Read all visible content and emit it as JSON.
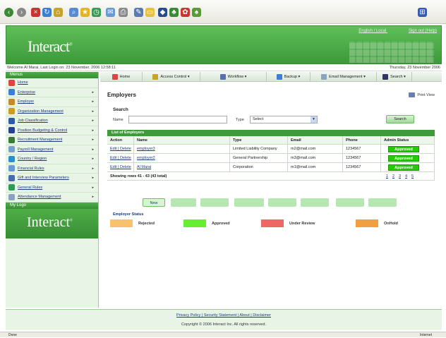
{
  "header": {
    "logo": "Interact",
    "logo_mark": "®",
    "links": [
      "English / Local",
      "Sign out (Help)"
    ]
  },
  "welcome": {
    "left": "Welcome Al Marai, Last Login on: 23 November, 2006 12:58:11",
    "right": "Thursday, 23 November 2006"
  },
  "sidebar": {
    "menu_label": "Menus",
    "items": [
      {
        "label": "Home",
        "color": "#d44"
      },
      {
        "label": "Enterprise",
        "color": "#3a7fd0"
      },
      {
        "label": "Employer",
        "color": "#c68a2a"
      },
      {
        "label": "Organization Management",
        "color": "#cc9b22"
      },
      {
        "label": "Job Classification",
        "color": "#2f5aa8"
      },
      {
        "label": "Position Budgeting & Control",
        "color": "#27418a"
      },
      {
        "label": "Recruitment Management",
        "color": "#3a7a35"
      },
      {
        "label": "Payroll Management",
        "color": "#7a9fcc"
      },
      {
        "label": "Country / Region",
        "color": "#2a8fd0"
      },
      {
        "label": "Financial Rules",
        "color": "#6a9ad4"
      },
      {
        "label": "Gift and Interview Parameters",
        "color": "#4a6ab0"
      },
      {
        "label": "General Rules",
        "color": "#2e9a54"
      },
      {
        "label": "Attendance Management",
        "color": "#8aa4c0"
      }
    ],
    "my_logo_label": "My Logo",
    "logo": "Interact"
  },
  "menubar": [
    {
      "label": "Home",
      "icon": "home-icon",
      "color": "#d44"
    },
    {
      "label": "Access Control ▾",
      "icon": "key-icon",
      "color": "#c9a22a"
    },
    {
      "label": "Workflow ▾",
      "icon": "workflow-icon",
      "color": "#5a6fb0"
    },
    {
      "label": "Backup ▾",
      "icon": "backup-icon",
      "color": "#3a7fd0"
    },
    {
      "label": "Email Management ▾",
      "icon": "email-icon",
      "color": "#8aa4c0"
    },
    {
      "label": "Search ▾",
      "icon": "search-icon",
      "color": "#336"
    }
  ],
  "page": {
    "title": "Employers",
    "print_view": "Print View"
  },
  "search": {
    "heading": "Search",
    "name_label": "Name",
    "type_label": "Type",
    "type_value": "Select",
    "button": "Search"
  },
  "table": {
    "caption": "List of Employers",
    "headers": [
      "Action",
      "Name",
      "Type",
      "Email",
      "Phone",
      "Admin Status"
    ],
    "rows": [
      {
        "action": "Edit | Delete",
        "name": "employer3",
        "type": "Limited Liability Company",
        "email": "m2@mail.com",
        "phone": "1234567",
        "status": "Approved"
      },
      {
        "action": "Edit | Delete",
        "name": "employer2",
        "type": "General Partnership",
        "email": "m3@mail.com",
        "phone": "1234567",
        "status": "Approved"
      },
      {
        "action": "Edit | Delete",
        "name": "Al Marai",
        "type": "Corporation",
        "email": "m1@mail.com",
        "phone": "1234567",
        "status": "Approved"
      }
    ],
    "summary": "Showing rows 41 - 43   (43 total)",
    "pages": [
      "1",
      "2",
      "3",
      "4",
      "5"
    ]
  },
  "actions": {
    "new": "New"
  },
  "legend": {
    "caption": "Employer Status",
    "items": [
      {
        "label": "Rejected",
        "color": "#f7c26b"
      },
      {
        "label": "Approved",
        "color": "#66ee33"
      },
      {
        "label": "Under Review",
        "color": "#ee6666"
      },
      {
        "label": "OnHold",
        "color": "#f0a040"
      }
    ]
  },
  "footer": {
    "links": "Privacy Policy | Security Statement | About | Disclaimer",
    "copyright": "Copyright © 2006 Interact Inc. All rights reserved."
  },
  "statusbar": {
    "left": "Done",
    "right": "Internet"
  }
}
